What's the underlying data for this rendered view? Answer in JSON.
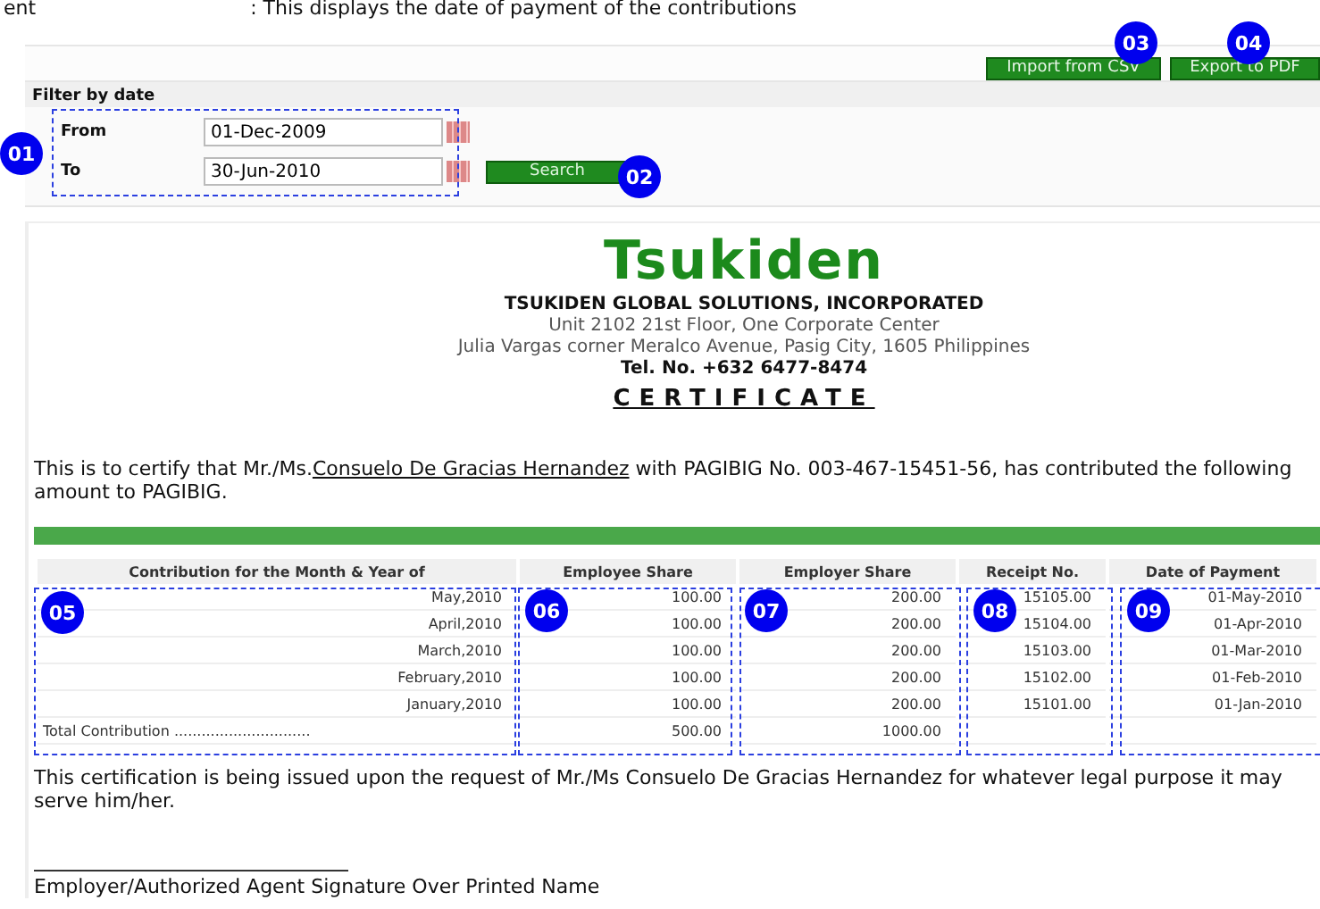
{
  "caption": {
    "term": "ent",
    "description": ": This displays the date of payment of the contributions"
  },
  "toolbar": {
    "buttons": [
      "Import from CSV",
      "Export to PDF"
    ]
  },
  "filter": {
    "heading": "Filter by date",
    "from_label": "From",
    "from_value": "01-Dec-2009",
    "to_label": "To",
    "to_value": "30-Jun-2010",
    "search_button": "Search"
  },
  "certificate": {
    "logo": "Tsukiden",
    "company": "TSUKIDEN GLOBAL SOLUTIONS, INCORPORATED",
    "address_1": "Unit 2102 21st Floor, One Corporate Center",
    "address_2": "Julia Vargas corner Meralco Avenue, Pasig City, 1605 Philippines",
    "tel": "Tel. No. +632 6477-8474",
    "title": "CERTIFICATE",
    "intro_before": "This is to certify that Mr./Ms.",
    "intro_name": "Consuelo De Gracias Hernandez",
    "intro_after": " with PAGIBIG No. 003-467-15451-56, has contributed the following amount to PAGIBIG.",
    "closing": "This certification is being issued upon the request of Mr./Ms Consuelo De Gracias Hernandez for whatever legal purpose it may serve him/her.",
    "signature_label": "Employer/Authorized Agent Signature Over Printed Name"
  },
  "table": {
    "columns": [
      "Contribution for the Month & Year of",
      "Employee Share",
      "Employer Share",
      "Receipt No.",
      "Date of Payment"
    ],
    "rows": [
      [
        "May,2010",
        "100.00",
        "200.00",
        "15105.00",
        "01-May-2010"
      ],
      [
        "April,2010",
        "100.00",
        "200.00",
        "15104.00",
        "01-Apr-2010"
      ],
      [
        "March,2010",
        "100.00",
        "200.00",
        "15103.00",
        "01-Mar-2010"
      ],
      [
        "February,2010",
        "100.00",
        "200.00",
        "15102.00",
        "01-Feb-2010"
      ],
      [
        "January,2010",
        "100.00",
        "200.00",
        "15101.00",
        "01-Jan-2010"
      ]
    ],
    "total": {
      "label": "Total Contribution ..............................",
      "employee": "500.00",
      "employer": "1000.00"
    }
  },
  "callouts": [
    "01",
    "02",
    "03",
    "04",
    "05",
    "06",
    "07",
    "08",
    "09"
  ]
}
